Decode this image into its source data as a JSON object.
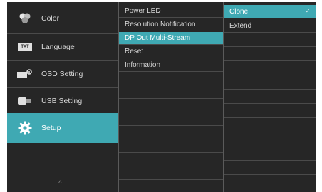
{
  "categories": [
    {
      "label": "Color",
      "icon": "color-icon"
    },
    {
      "label": "Language",
      "icon": "language-icon",
      "badge": "TXT"
    },
    {
      "label": "OSD Setting",
      "icon": "osd-setting-icon"
    },
    {
      "label": "USB Setting",
      "icon": "usb-setting-icon"
    },
    {
      "label": "Setup",
      "icon": "setup-gear-icon"
    }
  ],
  "active_category": "Setup",
  "scroll_up_glyph": "^",
  "submenu": [
    {
      "label": "Power LED"
    },
    {
      "label": "Resolution Notification"
    },
    {
      "label": "DP Out Multi-Stream"
    },
    {
      "label": "Reset"
    },
    {
      "label": "Information"
    }
  ],
  "active_submenu": "DP Out Multi-Stream",
  "options": [
    {
      "label": "Clone",
      "selected_mark": "✓"
    },
    {
      "label": "Extend"
    }
  ],
  "selected_option": "Clone",
  "colors": {
    "accent": "#3fa9b3",
    "panel": "#262626"
  }
}
